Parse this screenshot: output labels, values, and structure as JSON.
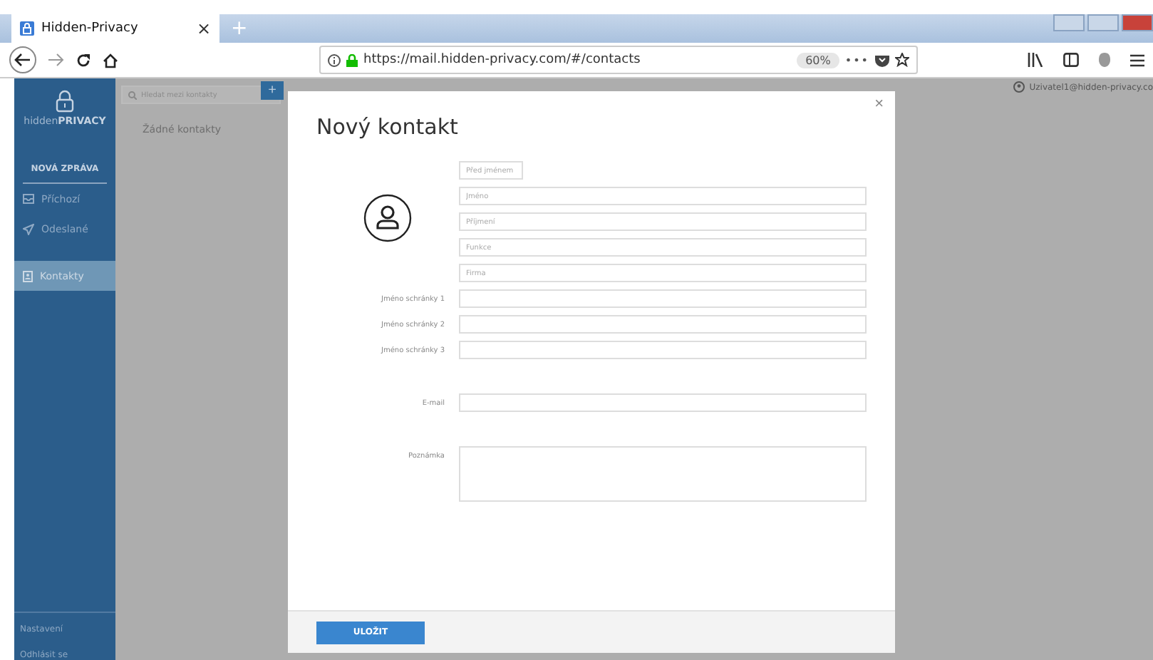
{
  "browser": {
    "tab": {
      "title": "Hidden-Privacy",
      "close": "×",
      "new_tab": "+"
    },
    "url": "https://mail.hidden-privacy.com/#/contacts",
    "zoom": "60%",
    "more": "•••"
  },
  "sidebar": {
    "logo_light": "hidden",
    "logo_bold": "PRIVACY",
    "compose": "NOVÁ ZPRÁVA",
    "items": [
      {
        "label": "Příchozí",
        "selected": false
      },
      {
        "label": "Odeslané",
        "selected": false
      },
      {
        "label": "Kontakty",
        "selected": true
      }
    ],
    "footer": [
      "Nastavení",
      "Odhlásit se"
    ]
  },
  "contacts": {
    "add": "+",
    "search_placeholder": "Hledat mezi kontakty",
    "empty": "Žádné kontakty"
  },
  "user": "Uzivatel1@hidden-privacy.co",
  "dialog": {
    "title": "Nový kontakt",
    "close": "×",
    "title_prefix_placeholder": "Před jménem",
    "name_fields": [
      {
        "placeholder": "Jméno"
      },
      {
        "placeholder": "Příjmení"
      },
      {
        "placeholder": "Funkce"
      },
      {
        "placeholder": "Firma"
      }
    ],
    "rows": [
      {
        "label": "Jméno schránky 1",
        "kind": "mailbox"
      },
      {
        "label": "Jméno schránky 2",
        "kind": "mailbox"
      },
      {
        "label": "Jméno schránky 3",
        "kind": "mailbox"
      },
      {
        "label": "E-mail",
        "kind": "email"
      },
      {
        "label": "Poznámka",
        "kind": "note"
      }
    ],
    "save": "ULOŽIT"
  }
}
